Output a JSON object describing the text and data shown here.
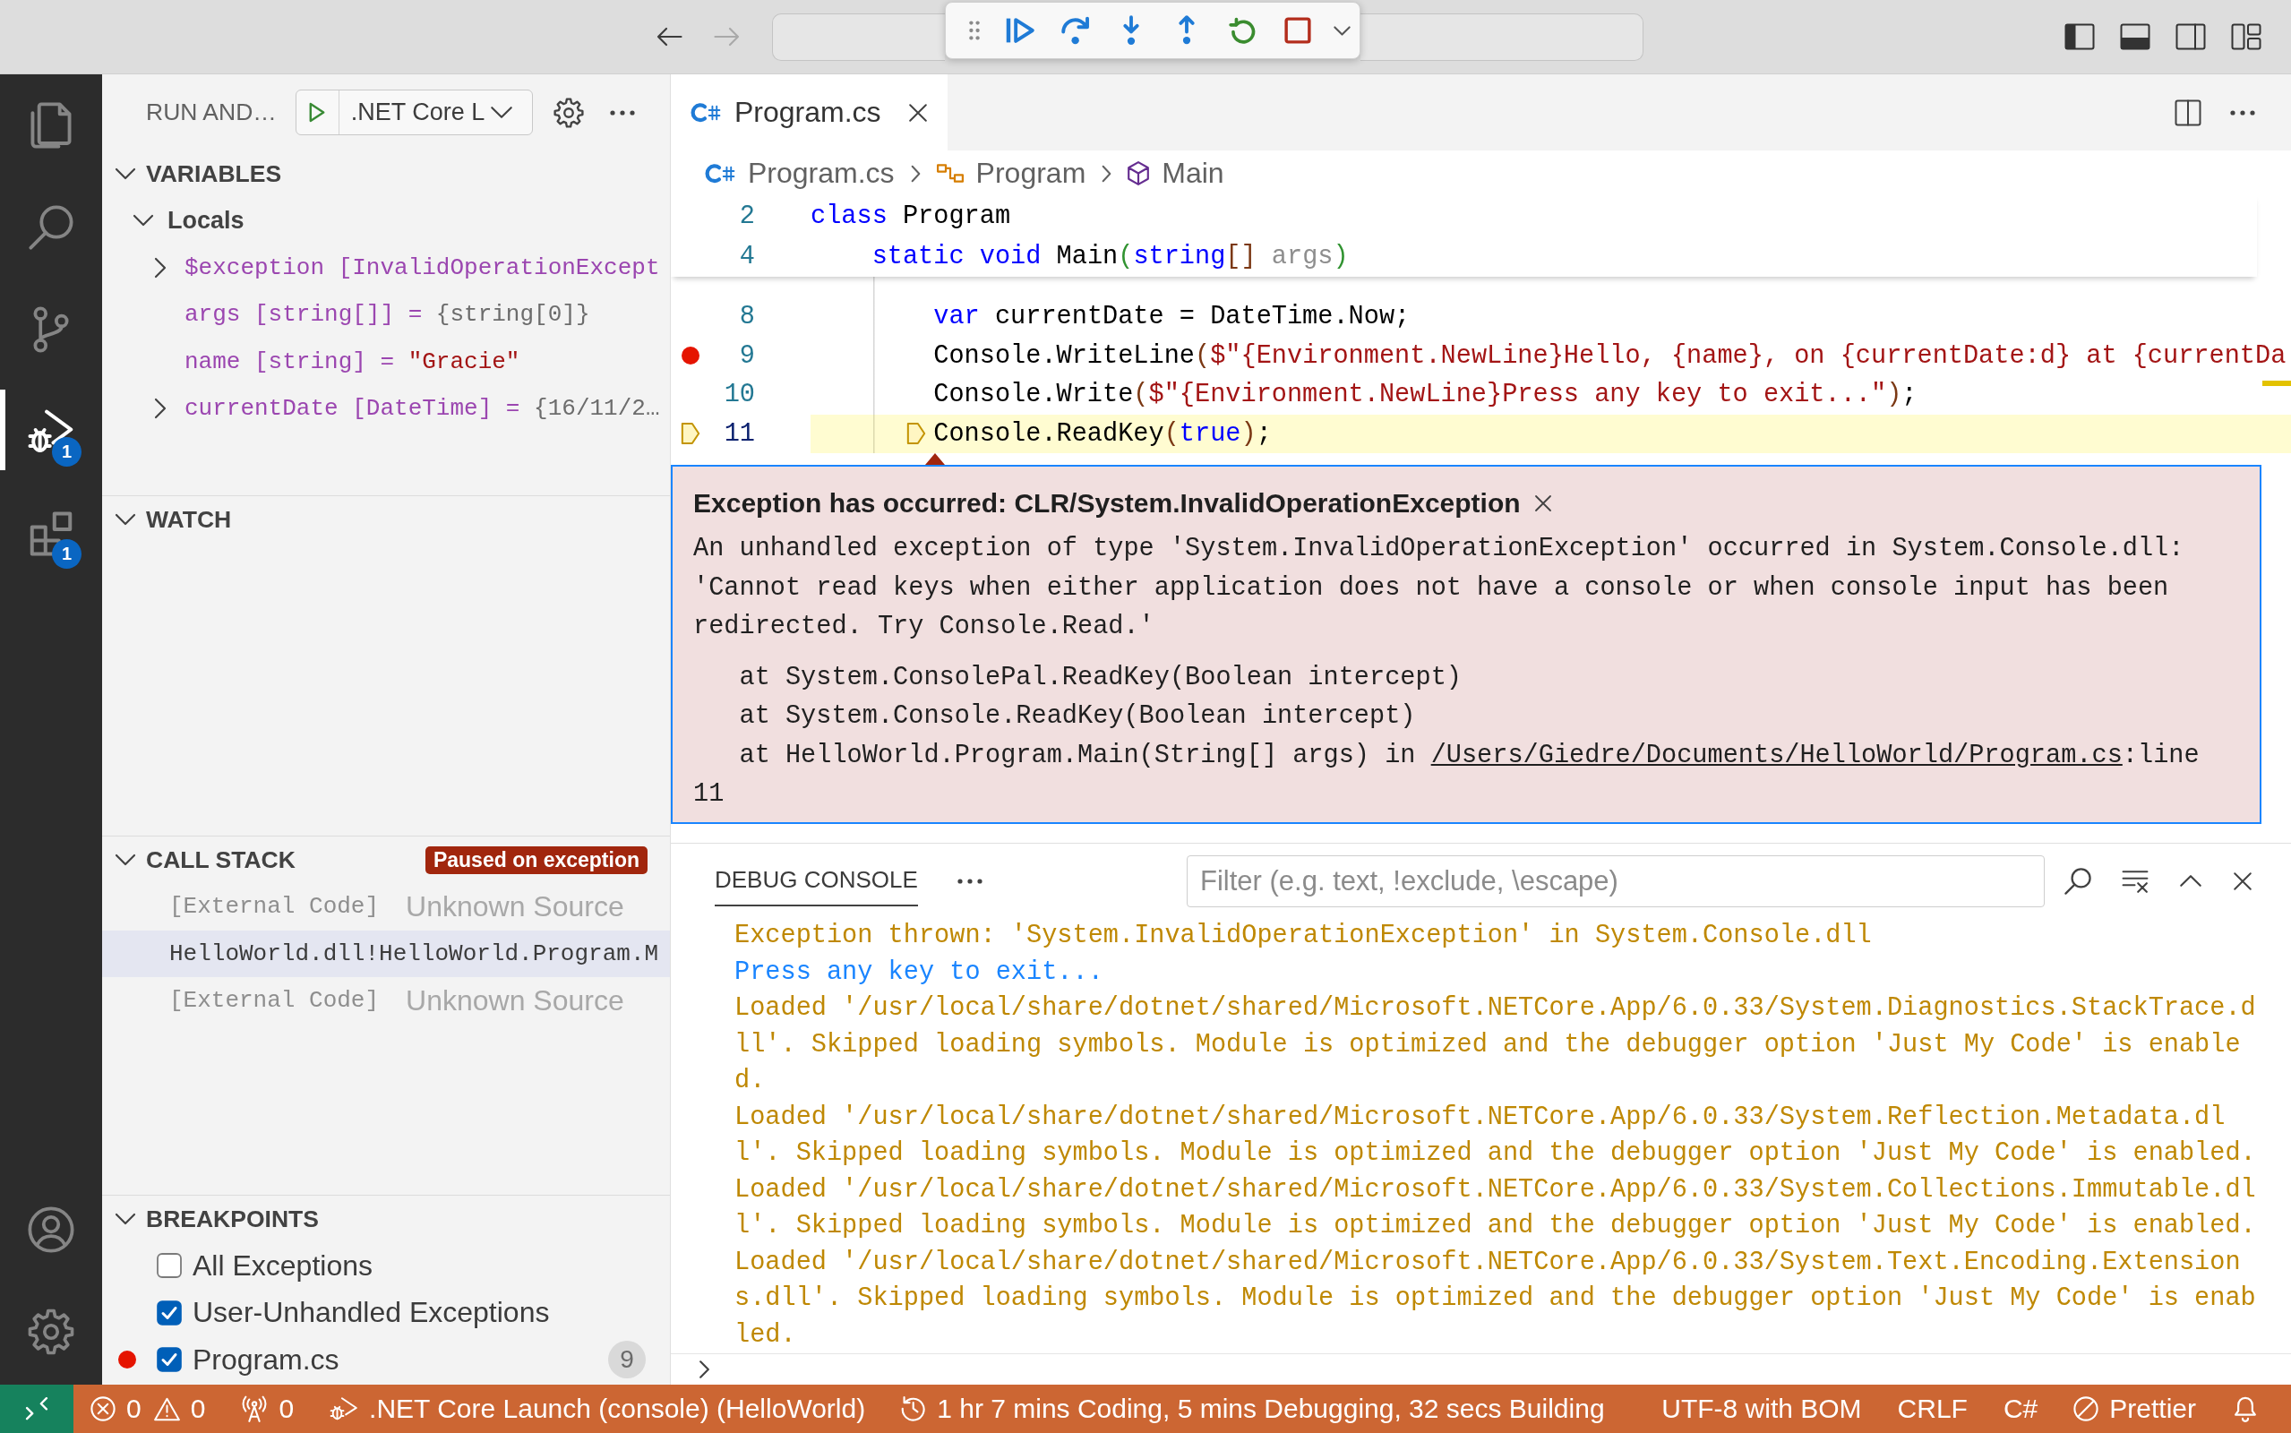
{
  "title_bar": {
    "navigation": [
      {
        "kind": "back",
        "disabled": false
      },
      {
        "kind": "forward",
        "disabled": true
      }
    ]
  },
  "activity_bar": {
    "items": [
      {
        "kind": "explorer",
        "selected": false
      },
      {
        "kind": "search",
        "selected": false
      },
      {
        "kind": "source_control",
        "selected": false
      },
      {
        "kind": "run_debug",
        "selected": true,
        "badge": "1"
      },
      {
        "kind": "extensions",
        "selected": false,
        "badge": "1"
      }
    ],
    "bottom": [
      {
        "kind": "account"
      },
      {
        "kind": "manage"
      }
    ]
  },
  "sidebar": {
    "title": "RUN AND…",
    "launch_config": ".NET Core L",
    "variables": {
      "title": "VARIABLES",
      "expanded": true,
      "scopes": [
        {
          "name": "Locals",
          "expanded": true,
          "children": [
            {
              "label": "$exception [InvalidOperationExcept",
              "expanded": false
            },
            {
              "kind": "object",
              "label": "args [string[]] =",
              "value": "{string[0]}"
            },
            {
              "kind": "string",
              "label": "name [string] =",
              "value": "\"Gracie\""
            },
            {
              "kind": "object",
              "label": "currentDate [DateTime] =",
              "value": "{16/11/2…",
              "expanded": false
            }
          ]
        }
      ]
    },
    "watch": {
      "title": "WATCH",
      "expanded": true
    },
    "call_stack": {
      "title": "CALL STACK",
      "expanded": true,
      "status": "Paused on exception",
      "frames": [
        {
          "kind": "external",
          "name": "[External Code]",
          "source": "Unknown Source",
          "selected": false
        },
        {
          "kind": "user",
          "name": "HelloWorld.dll!HelloWorld.Program.M",
          "selected": true
        },
        {
          "kind": "external",
          "name": "[External Code]",
          "source": "Unknown Source",
          "selected": false
        }
      ]
    },
    "breakpoints": {
      "title": "BREAKPOINTS",
      "expanded": true,
      "items": [
        {
          "kind": "exception",
          "label": "All Exceptions",
          "checked": false
        },
        {
          "kind": "exception",
          "label": "User-Unhandled Exceptions",
          "checked": true
        },
        {
          "kind": "file",
          "label": "Program.cs",
          "checked": true,
          "line": "9"
        }
      ]
    }
  },
  "editor": {
    "tabs": [
      {
        "label": "Program.cs",
        "selected": true
      }
    ],
    "breadcrumbs": [
      {
        "kind": "file",
        "label": "Program.cs"
      },
      {
        "kind": "class",
        "label": "Program"
      },
      {
        "kind": "method",
        "label": "Main"
      }
    ],
    "sticky_lines": [
      {
        "number": "2",
        "tokens": [
          {
            "kind": "keyword",
            "text": "class"
          },
          {
            "kind": "plain",
            "text": " Program"
          }
        ]
      },
      {
        "number": "4",
        "tokens": [
          {
            "kind": "keyword",
            "text": "    static"
          },
          {
            "kind": "keyword",
            "text": " void"
          },
          {
            "kind": "plain",
            "text": " Main"
          },
          {
            "kind": "bracket2",
            "text": "("
          },
          {
            "kind": "keyword",
            "text": "string"
          },
          {
            "kind": "bracket3",
            "text": "[]"
          },
          {
            "kind": "unused",
            "text": " args"
          },
          {
            "kind": "bracket2",
            "text": ")"
          }
        ]
      }
    ],
    "lines": [
      {
        "number": "8",
        "breakpoint": false,
        "current": false,
        "tokens": [
          {
            "kind": "keyword",
            "text": "        var"
          },
          {
            "kind": "plain",
            "text": " currentDate = DateTime.Now;"
          }
        ]
      },
      {
        "number": "9",
        "breakpoint": true,
        "current": false,
        "tokens": [
          {
            "kind": "plain",
            "text": "        Console.WriteLine"
          },
          {
            "kind": "bracket3",
            "text": "("
          },
          {
            "kind": "string",
            "text": "$\"{Environment.NewLine}Hello, {name}, on {currentDate:d} at {currentDa"
          }
        ]
      },
      {
        "number": "10",
        "breakpoint": false,
        "current": false,
        "tokens": [
          {
            "kind": "plain",
            "text": "        Console.Write"
          },
          {
            "kind": "bracket3",
            "text": "("
          },
          {
            "kind": "string",
            "text": "$\"{Environment.NewLine}Press any key to exit...\""
          },
          {
            "kind": "bracket3",
            "text": ")"
          },
          {
            "kind": "plain",
            "text": ";"
          }
        ]
      },
      {
        "number": "11",
        "breakpoint": false,
        "current": true,
        "tokens": [
          {
            "kind": "plain",
            "text": "        Console.ReadKey"
          },
          {
            "kind": "bracket3",
            "text": "("
          },
          {
            "kind": "keyword",
            "text": "true"
          },
          {
            "kind": "bracket3",
            "text": ")"
          },
          {
            "kind": "plain",
            "text": ";"
          }
        ]
      }
    ],
    "exception": {
      "title": "Exception has occurred: CLR/System.InvalidOperationException",
      "message": "An unhandled exception of type 'System.InvalidOperationException' occurred in System.Console.dll: 'Cannot read keys when either application does not have a console or when console input has been redirected. Try Console.Read.'",
      "stack": [
        {
          "text": "at System.ConsolePal.ReadKey(Boolean intercept)"
        },
        {
          "text": "at System.Console.ReadKey(Boolean intercept)"
        },
        {
          "text": "at HelloWorld.Program.Main(String[] args) in ",
          "link": "/Users/Giedre/Documents/HelloWorld/Program.cs",
          "after": ":line 11"
        }
      ]
    }
  },
  "debug_console": {
    "tabs": [
      {
        "label": "DEBUG CONSOLE",
        "selected": true
      }
    ],
    "filter": {
      "placeholder": "Filter (e.g. text, !exclude, \\escape)"
    },
    "output": [
      {
        "kind": "warning",
        "text": "Exception thrown: 'System.InvalidOperationException' in System.Console.dll"
      },
      {
        "kind": "info",
        "text": "Press any key to exit..."
      },
      {
        "kind": "warning",
        "text": "Loaded '/usr/local/share/dotnet/shared/Microsoft.NETCore.App/6.0.33/System.Diagnostics.StackTrace.dll'. Skipped loading symbols. Module is optimized and the debugger option 'Just My Code' is enabled."
      },
      {
        "kind": "warning",
        "text": "Loaded '/usr/local/share/dotnet/shared/Microsoft.NETCore.App/6.0.33/System.Reflection.Metadata.dll'. Skipped loading symbols. Module is optimized and the debugger option 'Just My Code' is enabled."
      },
      {
        "kind": "warning",
        "text": "Loaded '/usr/local/share/dotnet/shared/Microsoft.NETCore.App/6.0.33/System.Collections.Immutable.dll'. Skipped loading symbols. Module is optimized and the debugger option 'Just My Code' is enabled."
      },
      {
        "kind": "warning",
        "text": "Loaded '/usr/local/share/dotnet/shared/Microsoft.NETCore.App/6.0.33/System.Text.Encoding.Extensions.dll'. Skipped loading symbols. Module is optimized and the debugger option 'Just My Code' is enabled."
      }
    ]
  },
  "status_bar": {
    "errors": "0",
    "warnings": "0",
    "ports": "0",
    "launch": ".NET Core Launch (console) (HelloWorld)",
    "time": "1 hr 7 mins Coding, 5 mins Debugging, 32 secs Building",
    "encoding": "UTF-8 with BOM",
    "eol": "CRLF",
    "language": "C#",
    "formatter": "Prettier"
  }
}
